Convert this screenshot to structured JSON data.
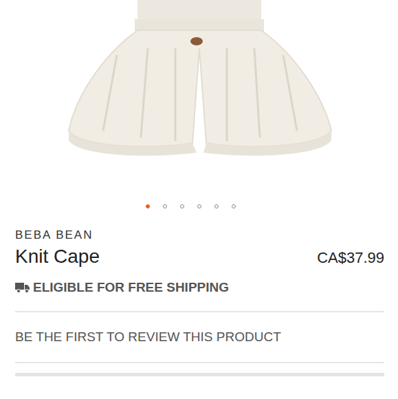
{
  "product_image": {
    "alt": ""
  },
  "carousel": {
    "dots": [
      {
        "selected": true
      },
      {
        "selected": false
      },
      {
        "selected": false
      },
      {
        "selected": false
      },
      {
        "selected": false
      },
      {
        "selected": false
      }
    ]
  },
  "brand": "BEBA BEAN",
  "title": "Knit Cape",
  "price": "CA$37.99",
  "shipping": {
    "label": "ELIGIBLE FOR FREE SHIPPING"
  },
  "reviews": {
    "prompt": "BE THE FIRST TO REVIEW THIS PRODUCT"
  }
}
